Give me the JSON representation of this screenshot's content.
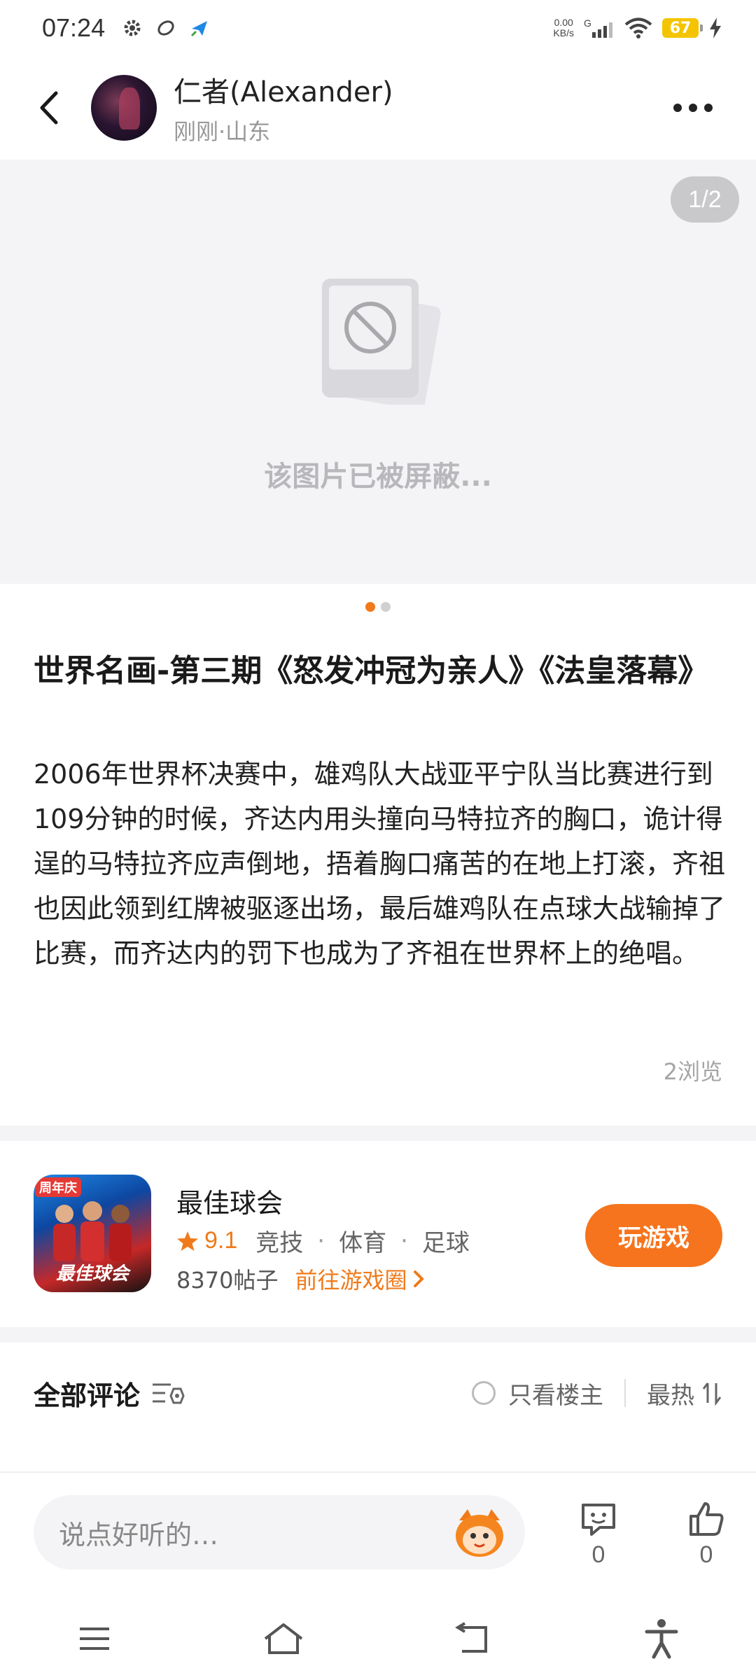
{
  "status_bar": {
    "time": "07:24",
    "net_speed_value": "0.00",
    "net_speed_unit": "KB/s",
    "signal_label": "G",
    "battery": "67"
  },
  "header": {
    "user_name": "仁者(Alexander)",
    "meta": "刚刚·山东"
  },
  "image": {
    "page_indicator": "1/2",
    "blocked_text": "该图片已被屏蔽..."
  },
  "post": {
    "title": "世界名画-第三期《怒发冲冠为亲人》《法皇落幕》",
    "body": "2006年世界杯决赛中，雄鸡队大战亚平宁队当比赛进行到109分钟的时候，齐达内用头撞向马特拉齐的胸口，诡计得逞的马特拉齐应声倒地，捂着胸口痛苦的在地上打滚，齐祖也因此领到红牌被驱逐出场，最后雄鸡队在点球大战输掉了比赛，而齐达内的罚下也成为了齐祖在世界杯上的绝唱。",
    "views": "2浏览"
  },
  "game": {
    "name": "最佳球会",
    "rating": "9.1",
    "tags": [
      "竞技",
      "体育",
      "足球"
    ],
    "tag_separator": "·",
    "posts": "8370帖子",
    "goto_label": "前往游戏圈",
    "play_label": "玩游戏",
    "icon_badge": "周年庆",
    "icon_logo": "最佳球会"
  },
  "comments": {
    "title": "全部评论",
    "only_op": "只看楼主",
    "sort": "最热"
  },
  "input_bar": {
    "placeholder": "说点好听的…",
    "comment_count": "0",
    "like_count": "0"
  },
  "colors": {
    "accent": "#f5741d",
    "background_gray": "#f4f4f6"
  },
  "icons": {
    "back": "back-arrow-icon",
    "more": "more-dots-icon",
    "blocked": "blocked-image-icon",
    "star": "star-icon",
    "filter": "filter-icon",
    "sort": "sort-icon",
    "comment": "comment-icon",
    "like": "thumbs-up-icon",
    "menu": "menu-icon",
    "home": "home-icon",
    "return": "return-icon",
    "accessibility": "accessibility-icon"
  }
}
